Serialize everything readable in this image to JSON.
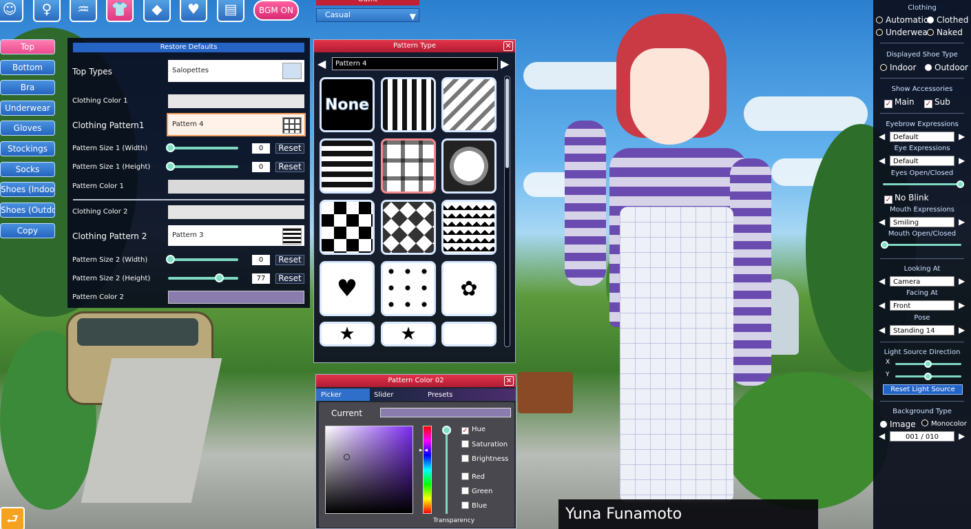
{
  "toolbar": {
    "icons": [
      {
        "name": "face-icon",
        "glyph": "☺"
      },
      {
        "name": "body-icon",
        "glyph": "♀"
      },
      {
        "name": "hair-icon",
        "glyph": "♒"
      },
      {
        "name": "clothing-icon",
        "glyph": "👕"
      },
      {
        "name": "accessory-icon",
        "glyph": "◆"
      },
      {
        "name": "heart-icon",
        "glyph": "♥"
      },
      {
        "name": "document-icon",
        "glyph": "▤"
      }
    ],
    "bgm_label": "BGM ON"
  },
  "outfit": {
    "label": "Outfit",
    "value": "Casual"
  },
  "categories": [
    "Top",
    "Bottom",
    "Bra",
    "Underwear",
    "Gloves",
    "Stockings",
    "Socks",
    "Shoes (Indoor)",
    "Shoes (Outdoor)",
    "Copy"
  ],
  "active_category": "Top",
  "settings": {
    "restore_defaults": "Restore Defaults",
    "top_types_label": "Top Types",
    "top_types_value": "Salopettes",
    "clothing_color_1": "Clothing Color 1",
    "clothing_pattern_1_label": "Clothing Pattern1",
    "clothing_pattern_1_value": "Pattern 4",
    "pattern_size_1_width_label": "Pattern Size 1 (Width)",
    "pattern_size_1_width_value": "0",
    "pattern_size_1_height_label": "Pattern Size 1 (Height)",
    "pattern_size_1_height_value": "0",
    "pattern_color_1": "Pattern Color 1",
    "clothing_color_2": "Clothing Color 2",
    "clothing_pattern_2_label": "Clothing Pattern 2",
    "clothing_pattern_2_value": "Pattern 3",
    "pattern_size_2_width_label": "Pattern Size 2 (Width)",
    "pattern_size_2_width_value": "0",
    "pattern_size_2_height_label": "Pattern Size 2 (Height)",
    "pattern_size_2_height_value": "77",
    "pattern_color_2": "Pattern Color 2",
    "reset_label": "Reset",
    "slider_levels": {
      "size1_width": 0,
      "size1_height": 0,
      "size2_width": 0,
      "size2_height": 0.77
    },
    "swatch_colors": {
      "clothing_color_1": "#eeeeee",
      "pattern_color_1": "#d9d9d9",
      "clothing_color_2": "#e4e4e4",
      "pattern_color_2": "#8a7dae"
    }
  },
  "pattern_window": {
    "title": "Pattern Type",
    "current": "Pattern 4",
    "none_label": "None",
    "selected_index": 4
  },
  "color_window": {
    "title": "Pattern Color 02",
    "tabs": [
      "Picker",
      "Slider",
      "Presets"
    ],
    "current_label": "Current",
    "current_color": "#8a7dae",
    "options": [
      {
        "label": "Hue",
        "checked": true
      },
      {
        "label": "Saturation",
        "checked": false
      },
      {
        "label": "Brightness",
        "checked": false
      },
      {
        "label": "Red",
        "checked": false
      },
      {
        "label": "Green",
        "checked": false
      },
      {
        "label": "Blue",
        "checked": false
      }
    ],
    "transparency_label": "Transparency"
  },
  "right_panel": {
    "clothing_title": "Clothing",
    "clothing_options": [
      "Automatic",
      "Clothed",
      "Underwear",
      "Naked"
    ],
    "clothing_selected": "Clothed",
    "shoe_title": "Displayed Shoe Type",
    "shoe_options": [
      "Indoor",
      "Outdoor"
    ],
    "shoe_selected": "Outdoor",
    "accessories_title": "Show Accessories",
    "accessories": [
      "Main",
      "Sub"
    ],
    "eyebrow_title": "Eyebrow Expressions",
    "eyebrow_value": "Default",
    "eye_title": "Eye Expressions",
    "eye_value": "Default",
    "eyes_open_title": "Eyes Open/Closed",
    "no_blink": "No Blink",
    "mouth_title": "Mouth Expressions",
    "mouth_value": "Smiling",
    "mouth_open_title": "Mouth Open/Closed",
    "looking_title": "Looking At",
    "looking_value": "Camera",
    "facing_title": "Facing At",
    "facing_value": "Front",
    "pose_title": "Pose",
    "pose_value": "Standing 14",
    "light_title": "Light Source Direction",
    "x_label": "X",
    "y_label": "Y",
    "reset_light": "Reset Light Source",
    "background_title": "Background Type",
    "background_options": [
      "Image",
      "Monocolor"
    ],
    "background_selected": "Image",
    "background_value": "001 / 010"
  },
  "character_name": "Yuna Funamoto",
  "back_glyph": "⮐"
}
